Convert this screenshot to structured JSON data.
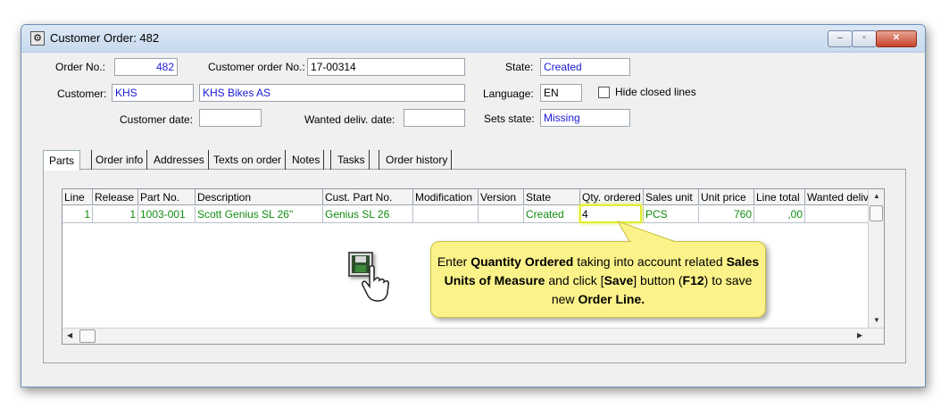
{
  "window": {
    "title": "Customer Order: 482",
    "min": "–",
    "max": "▫",
    "close": "✕"
  },
  "header": {
    "order_no_label": "Order No.:",
    "order_no": "482",
    "cust_order_no_label": "Customer order No.:",
    "cust_order_no": "17-00314",
    "state_label": "State:",
    "state": "Created",
    "customer_label": "Customer:",
    "customer_code": "KHS",
    "customer_name": "KHS Bikes AS",
    "language_label": "Language:",
    "language": "EN",
    "hide_closed_label": "Hide closed lines",
    "customer_date_label": "Customer date:",
    "customer_date": "",
    "wanted_deliv_label": "Wanted deliv. date:",
    "wanted_deliv": "",
    "sets_state_label": "Sets state:",
    "sets_state": "Missing"
  },
  "tabs": [
    "Parts",
    "Order info",
    "Addresses",
    "Texts on order",
    "Notes",
    "Tasks",
    "Order history"
  ],
  "grid": {
    "columns": [
      "Line",
      "Release",
      "Part No.",
      "Description",
      "Cust. Part No.",
      "Modification",
      "Version",
      "State",
      "Qty. ordered",
      "Sales unit",
      "Unit price",
      "Line total",
      "Wanted deliv"
    ],
    "rows": [
      [
        "1",
        "1",
        "1003-001",
        "Scott Genius SL 26\"",
        "Genius SL 26",
        "",
        "",
        "Created",
        "4",
        "PCS",
        "760",
        ",00",
        ""
      ]
    ]
  },
  "callout": {
    "t1": "Enter ",
    "b1": "Quantity Ordered",
    "t2": " taking into account related ",
    "b2": "Sales Units of Measure",
    "t3": " and click [",
    "b3": "Save",
    "t4": "] button (",
    "b4": "F12",
    "t5": ") to save new ",
    "b5": "Order Line."
  },
  "icons": {
    "save": "floppy-disk-icon",
    "hand": "hand-pointer-icon"
  }
}
